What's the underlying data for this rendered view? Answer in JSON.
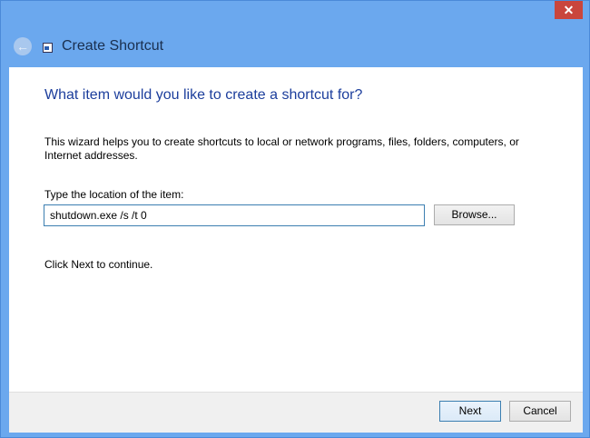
{
  "window": {
    "title": "Create Shortcut",
    "close_icon": "close-icon",
    "back_icon": "back-arrow-icon"
  },
  "content": {
    "heading": "What item would you like to create a shortcut for?",
    "description": "This wizard helps you to create shortcuts to local or network programs, files, folders, computers, or Internet addresses.",
    "location_label": "Type the location of the item:",
    "location_value": "shutdown.exe /s /t 0",
    "browse_label": "Browse...",
    "continue_text": "Click Next to continue."
  },
  "footer": {
    "next_label": "Next",
    "cancel_label": "Cancel"
  }
}
